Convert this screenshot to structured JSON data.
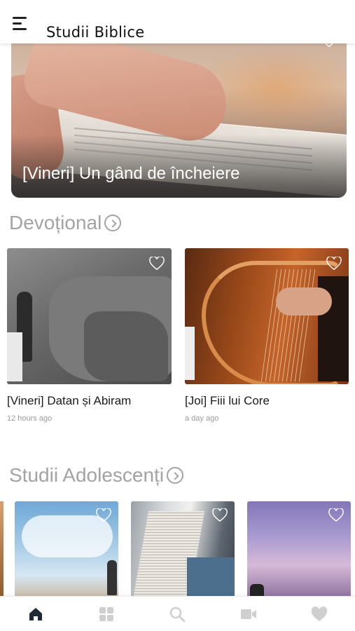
{
  "header": {
    "title": "Studii Biblice",
    "menu_icon": "hamburger-menu-icon"
  },
  "hero": {
    "title": "[Vineri] Un gând de încheiere",
    "favorite_icon": "heart-outline-icon"
  },
  "sections": {
    "devotional": {
      "title": "Devoțional",
      "more_icon": "circle-chevron-right-icon",
      "cards": [
        {
          "title": "[Vineri] Datan și Abiram",
          "time": "12 hours ago",
          "favorite_icon": "heart-outline-icon"
        },
        {
          "title": "[Joi] Fiii lui Core",
          "time": "a day ago",
          "favorite_icon": "heart-outline-icon"
        }
      ]
    },
    "adolescenti": {
      "title": "Studii Adolescenți",
      "more_icon": "circle-chevron-right-icon",
      "cards": [
        {
          "favorite_icon": "heart-outline-icon"
        },
        {
          "favorite_icon": "heart-outline-icon"
        },
        {
          "favorite_icon": "heart-outline-icon"
        }
      ]
    }
  },
  "bottom_nav": {
    "items": [
      {
        "icon": "home-icon",
        "active": true
      },
      {
        "icon": "grid-icon",
        "active": false
      },
      {
        "icon": "search-icon",
        "active": false
      },
      {
        "icon": "video-camera-icon",
        "active": false
      },
      {
        "icon": "heart-filled-icon",
        "active": false
      }
    ],
    "active_color": "#1f2a33",
    "inactive_color": "#cfcfcf"
  },
  "colors": {
    "section_title": "#a3a3a3",
    "card_title": "#1a1a1a",
    "timestamp": "#9a9a9a"
  }
}
